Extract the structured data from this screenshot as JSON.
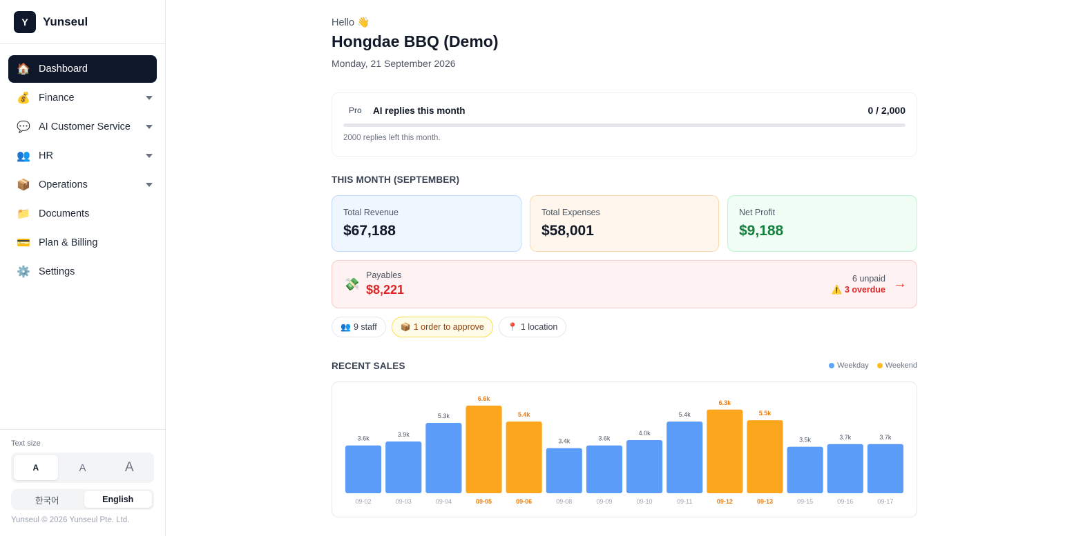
{
  "brand": {
    "logo_letter": "Y",
    "name": "Yunseul"
  },
  "nav": {
    "items": [
      {
        "id": "dashboard",
        "label": "Dashboard",
        "icon": "🏠",
        "icon_name": "house-icon",
        "active": true,
        "expandable": false
      },
      {
        "id": "finance",
        "label": "Finance",
        "icon": "💰",
        "icon_name": "money-bag-icon",
        "active": false,
        "expandable": true
      },
      {
        "id": "ai-customer-service",
        "label": "AI Customer Service",
        "icon": "💬",
        "icon_name": "chat-bubble-icon",
        "active": false,
        "expandable": true
      },
      {
        "id": "hr",
        "label": "HR",
        "icon": "👥",
        "icon_name": "people-icon",
        "active": false,
        "expandable": true
      },
      {
        "id": "operations",
        "label": "Operations",
        "icon": "📦",
        "icon_name": "package-icon",
        "active": false,
        "expandable": true
      },
      {
        "id": "documents",
        "label": "Documents",
        "icon": "📁",
        "icon_name": "folder-icon",
        "active": false,
        "expandable": false
      },
      {
        "id": "plan-billing",
        "label": "Plan & Billing",
        "icon": "💳",
        "icon_name": "credit-card-icon",
        "active": false,
        "expandable": false
      },
      {
        "id": "settings",
        "label": "Settings",
        "icon": "⚙️",
        "icon_name": "gear-icon",
        "active": false,
        "expandable": false
      }
    ]
  },
  "sidebar_bottom": {
    "text_size_label": "Text size",
    "text_size_options": [
      "A",
      "A",
      "A"
    ],
    "text_size_selected": 0,
    "languages": [
      "한국어",
      "English"
    ],
    "language_selected": 1,
    "copyright": "Yunseul © 2026 Yunseul Pte. Ltd."
  },
  "header": {
    "greeting": "Hello 👋",
    "store_name": "Hongdae BBQ (Demo)",
    "date": "Monday, 21 September 2026"
  },
  "quota": {
    "plan": "Pro",
    "title": "AI replies this month",
    "count": "0 / 2,000",
    "used_fraction": 0,
    "note": "2000 replies left this month."
  },
  "this_month": {
    "title": "THIS MONTH (SEPTEMBER)",
    "cards": [
      {
        "label": "Total Revenue",
        "value": "$67,188",
        "bg": "#eff6ff",
        "border": "#bfdbfe",
        "color": "#111827"
      },
      {
        "label": "Total Expenses",
        "value": "$58,001",
        "bg": "#fff7ed",
        "border": "#fed7aa",
        "color": "#111827"
      },
      {
        "label": "Net Profit",
        "value": "$9,188",
        "bg": "#f0fdf4",
        "border": "#bbf7d0",
        "color": "#15803d"
      }
    ]
  },
  "payables": {
    "icon": "💸",
    "label": "Payables",
    "value": "$8,221",
    "unpaid": "6 unpaid",
    "overdue": "⚠️ 3 overdue",
    "arrow": "→"
  },
  "chips": [
    {
      "icon": "👥",
      "label": "9 staff",
      "warn": false
    },
    {
      "icon": "📦",
      "label": "1 order to approve",
      "warn": true
    },
    {
      "icon": "📍",
      "label": "1 location",
      "warn": false
    }
  ],
  "recent_sales": {
    "title": "RECENT SALES",
    "legend": [
      {
        "label": "Weekday",
        "color": "#60a5fa"
      },
      {
        "label": "Weekend",
        "color": "#fbbf24"
      }
    ]
  },
  "chart_data": {
    "type": "bar",
    "categories": [
      "09-02",
      "09-03",
      "09-04",
      "09-05",
      "09-06",
      "09-08",
      "09-09",
      "09-10",
      "09-11",
      "09-12",
      "09-13",
      "09-15",
      "09-16",
      "09-17"
    ],
    "values": [
      3600,
      3900,
      5300,
      6600,
      5400,
      3400,
      3600,
      4000,
      5400,
      6300,
      5500,
      3500,
      3700,
      3700
    ],
    "value_labels": [
      "3.6k",
      "3.9k",
      "5.3k",
      "6.6k",
      "5.4k",
      "3.4k",
      "3.6k",
      "4.0k",
      "5.4k",
      "6.3k",
      "5.5k",
      "3.5k",
      "3.7k",
      "3.7k"
    ],
    "weekend": [
      false,
      false,
      false,
      true,
      true,
      false,
      false,
      false,
      false,
      true,
      true,
      false,
      false,
      false
    ],
    "series": [
      {
        "name": "Weekday",
        "color": "#5b9cf9"
      },
      {
        "name": "Weekend",
        "color": "#fba61c"
      }
    ],
    "weekend_label_color": "#ea7c0c",
    "label_color": "#4b5563",
    "tick_color": "#9ca3af",
    "ylim": [
      0,
      6600
    ],
    "grid": false,
    "legend_position": "top-right"
  }
}
